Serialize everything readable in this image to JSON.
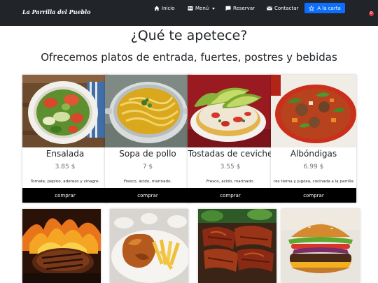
{
  "navbar": {
    "brand": "La Parrilla del Pueblo",
    "links": [
      {
        "label": "Inicio",
        "icon": "home-icon"
      },
      {
        "label": "Menú",
        "icon": "menu-card-icon"
      },
      {
        "label": "Reservar",
        "icon": "chat-icon"
      },
      {
        "label": "Contactar",
        "icon": "envelope-icon"
      }
    ],
    "cta": {
      "label": "A la carta",
      "icon": "star-icon"
    },
    "cart_count": "0",
    "colors": {
      "bar": "#212529",
      "cta": "#0d6efd",
      "badge": "#dc3545"
    }
  },
  "main": {
    "heading": "¿Qué te apetece?",
    "subheading": "Ofrecemos platos de entrada, fuertes, postres y bebidas"
  },
  "products": [
    {
      "name": "Ensalada",
      "price": "3.85 $",
      "description": "Tomate, pepino, aderezo y vinagre.",
      "button": "comprar",
      "image": "salad-photo"
    },
    {
      "name": "Sopa de pollo",
      "price": "7 $",
      "description": "Fresco, ácido, marinado.",
      "button": "comprar",
      "image": "chicken-noodle-soup-photo"
    },
    {
      "name": "Tostadas de ceviche",
      "price": "3.55 $",
      "description": "Fresco, ácido, marinado.",
      "button": "comprar",
      "image": "ceviche-tostadas-photo"
    },
    {
      "name": "Albóndigas",
      "price": "6.99 $",
      "description": "res tierna y jugosa, cocinada a la parrilla",
      "button": "comprar",
      "image": "meatball-soup-photo"
    }
  ],
  "more_products": [
    {
      "image": "grilled-steak-photo"
    },
    {
      "image": "roast-chicken-fries-photo"
    },
    {
      "image": "bbq-ribs-photo"
    },
    {
      "image": "burger-photo"
    }
  ]
}
